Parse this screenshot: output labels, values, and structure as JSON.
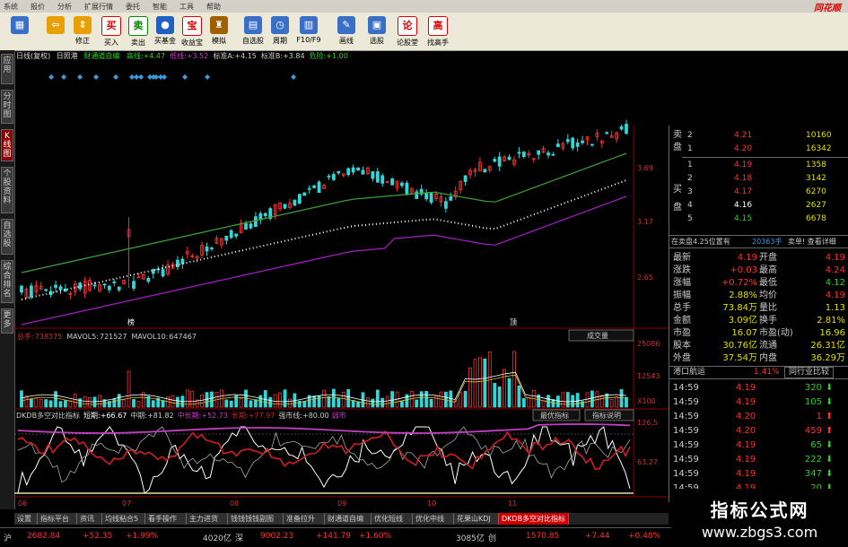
{
  "menu": [
    "系统",
    "报价",
    "分析",
    "扩展行情",
    "委托",
    "智能",
    "工具",
    "帮助"
  ],
  "brand": "同花顺",
  "toolbar": [
    {
      "label": "",
      "icon": "grid-icon",
      "color": "#3a6fc8"
    },
    {
      "label": "",
      "icon": "back-arrow-icon",
      "color": "#e8a000"
    },
    {
      "label": "修正",
      "icon": "up-down-arrow-icon",
      "color": "#e8a000"
    },
    {
      "label": "买入",
      "icon": "buy-icon",
      "glyph": "买",
      "color": "#d00"
    },
    {
      "label": "卖出",
      "icon": "sell-icon",
      "glyph": "卖",
      "color": "#080"
    },
    {
      "label": "买基金",
      "icon": "fund-icon",
      "color": "#2060c0"
    },
    {
      "label": "收益宝",
      "icon": "treasure-icon",
      "glyph": "宝",
      "color": "#d00"
    },
    {
      "label": "模拟",
      "icon": "simulate-icon",
      "color": "#a06000"
    },
    {
      "label": "自选股",
      "icon": "watchlist-icon",
      "color": "#3a6fc8"
    },
    {
      "label": "周期",
      "icon": "clock-icon",
      "color": "#3a6fc8"
    },
    {
      "label": "F10/F9",
      "icon": "f10-icon",
      "color": "#3a6fc8"
    },
    {
      "label": "画线",
      "icon": "pencil-icon",
      "color": "#3a6fc8"
    },
    {
      "label": "选股",
      "icon": "select-stock-icon",
      "color": "#3a6fc8"
    },
    {
      "label": "论股堂",
      "icon": "forum-icon",
      "glyph": "论",
      "color": "#d00"
    },
    {
      "label": "找高手",
      "icon": "expert-icon",
      "glyph": "高",
      "color": "#d00"
    }
  ],
  "left_tabs": [
    {
      "label": "应用",
      "active": false
    },
    {
      "label": "分时图",
      "active": false
    },
    {
      "label": "K线图",
      "active": true
    },
    {
      "label": "个股资料",
      "active": false
    },
    {
      "label": "自选股",
      "active": false
    },
    {
      "label": "综合排名",
      "active": false
    },
    {
      "label": "更多",
      "active": false
    }
  ],
  "indicator_header": {
    "name": "日线(复权)",
    "code": "日照港",
    "ind": "财通道自编",
    "items": [
      {
        "label": "高线:",
        "value": "+4.47",
        "color": "#2cd02c"
      },
      {
        "label": "低线:",
        "value": "+3.52",
        "color": "#c040c0"
      },
      {
        "label": "标准A:",
        "value": "+4.15",
        "color": "#ccc"
      },
      {
        "label": "标准B:",
        "value": "+3.84",
        "color": "#ccc"
      },
      {
        "label": "危险:",
        "value": "+1.00",
        "color": "#2cd02c"
      }
    ]
  },
  "price_axis": [
    "3.69",
    "3.17",
    "2.65"
  ],
  "volume": {
    "title": "总手:",
    "total": "738375",
    "ma5_label": "MAVOL5:",
    "ma5": "721527",
    "ma10_label": "MAVOL10:",
    "ma10": "647467",
    "dropdown": "成交量",
    "axis": [
      "25086",
      "12543",
      "X100"
    ]
  },
  "dkdb": {
    "title": "DKDB多空对比指标",
    "items": [
      {
        "label": "短期:",
        "value": "+66.67",
        "color": "#fff"
      },
      {
        "label": "中期:",
        "value": "+81.82",
        "color": "#ccc"
      },
      {
        "label": "中长期:",
        "value": "+52.73",
        "color": "#c040c0"
      },
      {
        "label": "长期:",
        "value": "+77.97",
        "color": "#d02020"
      },
      {
        "label": "强市线:",
        "value": "+80.00",
        "color": "#ccc"
      }
    ],
    "tail": "弱市",
    "btn1": "最优指标",
    "btn2": "指标说明",
    "axis": [
      "126.5",
      "63.27"
    ]
  },
  "chart_markers": {
    "a": "榜",
    "b": "顶"
  },
  "x_axis": [
    "06",
    "07",
    "08",
    "09",
    "10",
    "11"
  ],
  "orderbook": {
    "sell_label": "卖盘",
    "buy_label": "买盘",
    "sell": [
      {
        "n": "2",
        "p": "4.21",
        "v": "10160"
      },
      {
        "n": "1",
        "p": "4.20",
        "v": "16342"
      }
    ],
    "buy": [
      {
        "n": "1",
        "p": "4.19",
        "v": "1358"
      },
      {
        "n": "2",
        "p": "4.18",
        "v": "3142"
      },
      {
        "n": "3",
        "p": "4.17",
        "v": "6270"
      },
      {
        "n": "4",
        "p": "4.16",
        "v": "2627"
      },
      {
        "n": "5",
        "p": "4.15",
        "v": "6678"
      }
    ],
    "info_left": "在卖盘4.25位置有",
    "info_mid": "20363手",
    "info_right": "卖单! 查看详细"
  },
  "quote": [
    {
      "l1": "最新",
      "v1": "4.19",
      "l2": "开盘",
      "v2": "4.19"
    },
    {
      "l1": "涨跌",
      "v1": "+0.03",
      "l2": "最高",
      "v2": "4.24"
    },
    {
      "l1": "涨幅",
      "v1": "+0.72%",
      "l2": "最低",
      "v2": "4.12"
    },
    {
      "l1": "振幅",
      "v1": "2.88%",
      "l2": "均价",
      "v2": "4.19"
    },
    {
      "l1": "总手",
      "v1": "73.84万",
      "l2": "量比",
      "v2": "1.13"
    },
    {
      "l1": "金额",
      "v1": "3.09亿",
      "l2": "换手",
      "v2": "2.81%"
    },
    {
      "l1": "市盈",
      "v1": "16.07",
      "l2": "市盈(动)",
      "v2": "16.96"
    },
    {
      "l1": "股本",
      "v1": "30.76亿",
      "l2": "流通",
      "v2": "26.31亿"
    },
    {
      "l1": "外盘",
      "v1": "37.54万",
      "l2": "内盘",
      "v2": "36.29万"
    }
  ],
  "sector": {
    "name": "港口航运",
    "pct": "1.41%",
    "btn": "同行业比较"
  },
  "ticks": [
    {
      "t": "14:59",
      "p": "4.19",
      "v": "320",
      "d": "down"
    },
    {
      "t": "14:59",
      "p": "4.19",
      "v": "105",
      "d": "down"
    },
    {
      "t": "14:59",
      "p": "4.20",
      "v": "1",
      "d": "up"
    },
    {
      "t": "14:59",
      "p": "4.20",
      "v": "459",
      "d": "up"
    },
    {
      "t": "14:59",
      "p": "4.19",
      "v": "65",
      "d": "down"
    },
    {
      "t": "14:59",
      "p": "4.19",
      "v": "222",
      "d": "down"
    },
    {
      "t": "14:59",
      "p": "4.19",
      "v": "347",
      "d": "down"
    },
    {
      "t": "14:59",
      "p": "4.19",
      "v": "20",
      "d": "down"
    }
  ],
  "bottom_tabs": [
    {
      "label": "设置",
      "active": false
    },
    {
      "label": "指标平台",
      "active": false
    },
    {
      "label": "资讯",
      "active": false
    },
    {
      "label": "均线粘合5",
      "active": false
    },
    {
      "label": "看手操作",
      "active": false
    },
    {
      "label": "主力进货",
      "active": false
    },
    {
      "label": "钱钱钱钱副图",
      "active": false
    },
    {
      "label": "准备拉升",
      "active": false
    },
    {
      "label": "财通道自编",
      "active": false
    },
    {
      "label": "优化短线",
      "active": false
    },
    {
      "label": "优化中线",
      "active": false
    },
    {
      "label": "花果山KDJ",
      "active": false
    },
    {
      "label": "DKDB多空对比指标",
      "active": true
    }
  ],
  "status": {
    "sh_label": "沪",
    "sh_val": "2682.84",
    "sh_chg": "+52.35",
    "sh_pct": "+1.99%",
    "sh_amt": "4020亿",
    "sz_label": "深",
    "sz_val": "9002.23",
    "sz_chg": "+141.79",
    "sz_pct": "+1.60%",
    "sz_amt": "3085亿",
    "cy_label": "创",
    "cy_val": "1570.85",
    "cy_chg": "+7.44",
    "cy_pct": "+0.48%"
  },
  "watermark": {
    "line1": "指标公式网",
    "line2": "www.zbgs3.com"
  }
}
